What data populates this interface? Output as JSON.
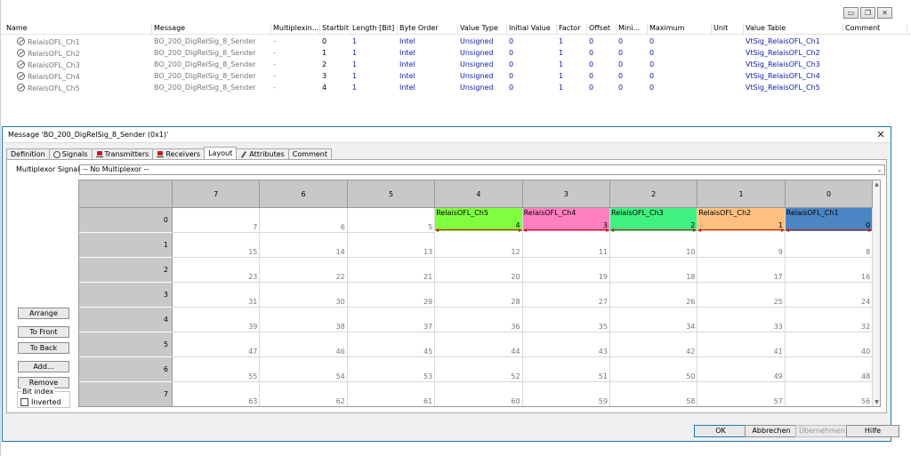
{
  "window_controls": {
    "minimize": "▭",
    "restore": "❐",
    "close": "✕"
  },
  "table": {
    "columns": [
      "Name",
      "Message",
      "Multiplexin...",
      "Startbit",
      "Length [Bit]",
      "Byte Order",
      "Value Type",
      "Initial Value",
      "Factor",
      "Offset",
      "Mini...",
      "Maximum",
      "Unit",
      "Value Table",
      "Comment"
    ],
    "rows": [
      {
        "name": "RelaisOFL_Ch1",
        "message": "BO_200_DigRelSig_8_Sender",
        "mux": "-",
        "startbit": "0",
        "length": "1",
        "byte_order": "Intel",
        "value_type": "Unsigned",
        "initial": "0",
        "factor": "1",
        "offset": "0",
        "min": "0",
        "max": "0",
        "unit": "",
        "value_table": "VtSig_RelaisOFL_Ch1",
        "comment": ""
      },
      {
        "name": "RelaisOFL_Ch2",
        "message": "BO_200_DigRelSig_8_Sender",
        "mux": "-",
        "startbit": "1",
        "length": "1",
        "byte_order": "Intel",
        "value_type": "Unsigned",
        "initial": "0",
        "factor": "1",
        "offset": "0",
        "min": "0",
        "max": "0",
        "unit": "",
        "value_table": "VtSig_RelaisOFL_Ch2",
        "comment": ""
      },
      {
        "name": "RelaisOFL_Ch3",
        "message": "BO_200_DigRelSig_8_Sender",
        "mux": "-",
        "startbit": "2",
        "length": "1",
        "byte_order": "Intel",
        "value_type": "Unsigned",
        "initial": "0",
        "factor": "1",
        "offset": "0",
        "min": "0",
        "max": "0",
        "unit": "",
        "value_table": "VtSig_RelaisOFL_Ch3",
        "comment": ""
      },
      {
        "name": "RelaisOFL_Ch4",
        "message": "BO_200_DigRelSig_8_Sender",
        "mux": "-",
        "startbit": "3",
        "length": "1",
        "byte_order": "Intel",
        "value_type": "Unsigned",
        "initial": "0",
        "factor": "1",
        "offset": "0",
        "min": "0",
        "max": "0",
        "unit": "",
        "value_table": "VtSig_RelaisOFL_Ch4",
        "comment": ""
      },
      {
        "name": "RelaisOFL_Ch5",
        "message": "BO_200_DigRelSig_8_Sender",
        "mux": "-",
        "startbit": "4",
        "length": "1",
        "byte_order": "Intel",
        "value_type": "Unsigned",
        "initial": "0",
        "factor": "1",
        "offset": "0",
        "min": "0",
        "max": "0",
        "unit": "",
        "value_table": "VtSig_RelaisOFL_Ch5",
        "comment": ""
      }
    ]
  },
  "dialog": {
    "title": "Message 'BO_200_DigRelSig_8_Sender (0x1)'",
    "close": "✕",
    "tabs": [
      "Definition",
      "Signals",
      "Transmitters",
      "Receivers",
      "Layout",
      "Attributes",
      "Comment"
    ],
    "active_tab": "Layout",
    "mux_label": "Multiplexor Signal:",
    "mux_value": "-- No Multiplexor --",
    "side_buttons": {
      "arrange": "Arrange",
      "to_front": "To Front",
      "to_back": "To Back",
      "add": "Add...",
      "remove": "Remove"
    },
    "bit_index_label": "Bit index",
    "inverted_label": "Inverted",
    "grid": {
      "col_headers": [
        "7",
        "6",
        "5",
        "4",
        "3",
        "2",
        "1",
        "0"
      ],
      "row_headers": [
        "0",
        "1",
        "2",
        "3",
        "4",
        "5",
        "6",
        "7"
      ],
      "signals": [
        {
          "name": "RelaisOFL_Ch5",
          "startbit": "4",
          "color": "#80ff40"
        },
        {
          "name": "RelaisOFL_Ch4",
          "startbit": "3",
          "color": "#ff80c0"
        },
        {
          "name": "RelaisOFL_Ch3",
          "startbit": "2",
          "color": "#40f080"
        },
        {
          "name": "RelaisOFL_Ch2",
          "startbit": "1",
          "color": "#ffc080"
        },
        {
          "name": "RelaisOFL_Ch1",
          "startbit": "0",
          "color": "#4a86c4"
        }
      ]
    },
    "footer": {
      "ok": "OK",
      "cancel": "Abbrechen",
      "apply": "Übernehmen",
      "help": "Hilfe"
    }
  }
}
